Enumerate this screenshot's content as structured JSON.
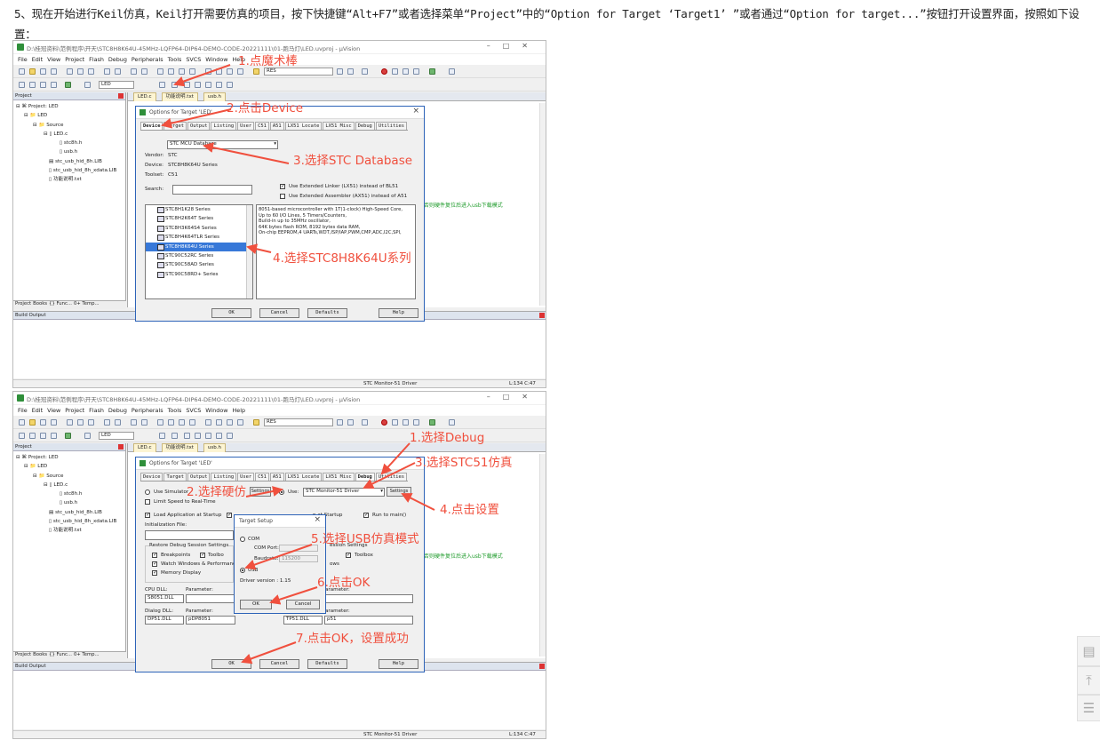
{
  "intro": "5、现在开始进行Keil仿真，Keil打开需要仿真的项目，按下快捷键“Alt+F7”或者选择菜单“Project”中的“Option for Target  ‘Target1’ ”或者通过“Option for target...”按钮打开设置界面，按照如下设置：",
  "uvision": {
    "title": "D:\\桂冠资料\\范例程序\\开天\\STC8H8K64U-45MHz-LQFP64-DIP64-DEMO-CODE-20221111\\01-跑马灯\\LED.uvproj - µVision",
    "menus": [
      "File",
      "Edit",
      "View",
      "Project",
      "Flash",
      "Debug",
      "Peripherals",
      "Tools",
      "SVCS",
      "Window",
      "Help"
    ],
    "toolbar_combo": "RES",
    "target_combo": "LED",
    "project_header": "Project",
    "tree": [
      "Project: LED",
      "LED",
      "Source",
      "LED.c",
      "stc8h.h",
      "usb.h",
      "stc_usb_hid_8h.LIB",
      "stc_usb_hid_8h_xdata.LIB",
      "功能说明.txt"
    ],
    "panel_tabs": [
      "Project",
      "Books",
      "{} Func...",
      "0+ Temp..."
    ],
    "editor_tabs": [
      "LED.c",
      "功能说明.txt",
      "usb.h"
    ],
    "green_comment": "否则硬件复位后进入usb下载模式",
    "build_output": "Build Output",
    "status_driver": "STC Monitor-51 Driver",
    "status_pos": "L:134 C:47"
  },
  "dialog1": {
    "title": "Options for Target 'LED'",
    "tabs": [
      "Device",
      "Target",
      "Output",
      "Listing",
      "User",
      "C51",
      "A51",
      "LX51 Locate",
      "LX51 Misc",
      "Debug",
      "Utilities"
    ],
    "database": "STC MCU Database",
    "vendor_label": "Vendor:",
    "vendor": "STC",
    "device_label": "Device:",
    "device": "STC8H8K64U Series",
    "toolset_label": "Toolset:",
    "toolset": "C51",
    "search_label": "Search:",
    "check_lx51": "Use Extended Linker (LX51) instead of BL51",
    "check_ax51": "Use Extended Assembler (AX51) instead of A51",
    "devices": [
      "STC8H1K28 Series",
      "STC8H2K64T Series",
      "STC8H3K64S4 Series",
      "STC8H4K64TLR Series",
      "STC8H8K64U Series",
      "STC90C52RC Series",
      "STC90C58AD Series",
      "STC90C58RD+ Series"
    ],
    "selected_index": 4,
    "description": [
      "8051-based microcontroller with 1T(1-clock) High-Speed Core,",
      "Up to 60 I/O Lines, 5 Timers/Counters,",
      "Build-in up to 35MHz oscillator,",
      "64K bytes flash ROM, 8192 bytes data RAM,",
      "On-chip EEPROM,4 UARTs,WDT,ISP/IAP,PWM,CMP,ADC,I2C,SPI,"
    ],
    "buttons": [
      "OK",
      "Cancel",
      "Defaults",
      "Help"
    ]
  },
  "annotations1": [
    "1.点魔术棒",
    "2.点击Device",
    "3.选择STC Database",
    "4.选择STC8H8K64U系列"
  ],
  "dialog2": {
    "title": "Options for Target 'LED'",
    "tabs": [
      "Device",
      "Target",
      "Output",
      "Listing",
      "User",
      "C51",
      "A51",
      "LX51 Locate",
      "LX51 Misc",
      "Debug",
      "Utilities"
    ],
    "use_simulator": "Use Simulator",
    "settings": "Settings",
    "use": "Use:",
    "driver": "STC Monitor-51 Driver",
    "limit_speed": "Limit Speed to Real-Time",
    "load_app": "Load Application at Startup",
    "run_to_main": "Run to main()",
    "load_app_right": "n at Startup",
    "init_file": "Initialization File:",
    "restore": "Restore Debug Session Settings",
    "breakpoints": "Breakpoints",
    "toolbox": "Toolbo",
    "toolbox_right": "Toolbox",
    "session_settings": "ession Settings",
    "watch": "Watch Windows & Performance",
    "memory": "Memory Display",
    "ows": "ows",
    "cpu_dll": "CPU DLL:",
    "cpu_param": "Parameter:",
    "cpu_val": "S8051.DLL",
    "dialog_dll": "Dialog DLL:",
    "dialog_param": "Parameter:",
    "dialog_val": "DP51.DLL",
    "dialog_pval": "pDP8051",
    "right_param": "arameter:",
    "tp_dll": "TP51.DLL",
    "tp_val": "p51",
    "buttons": [
      "OK",
      "Cancel",
      "Defaults",
      "Help"
    ]
  },
  "target_setup": {
    "title": "Target Setup",
    "com": "COM",
    "com_port": "COM Port:",
    "baudrate": "Baudrate:",
    "baud_value": "115200",
    "usb": "USB",
    "driver_version": "Driver version : 1.15",
    "ok": "OK",
    "cancel": "Cancel"
  },
  "annotations2": [
    "1.选择Debug",
    "3.选择STC51仿真",
    "2.选择硬仿",
    "4.点击设置",
    "5.选择USB仿真模式",
    "6.点击OK",
    "7.点击OK，设置成功"
  ],
  "side_icons": [
    "comment-icon",
    "back-to-top-icon",
    "list-icon"
  ]
}
